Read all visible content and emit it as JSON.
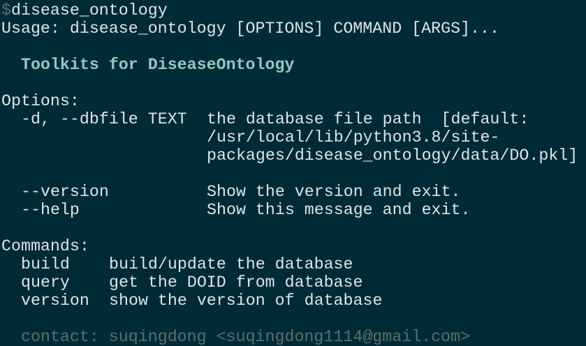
{
  "prompt": {
    "symbol": "$",
    "command": "disease_ontology"
  },
  "usage": "Usage: disease_ontology [OPTIONS] COMMAND [ARGS]...",
  "description": "Toolkits for DiseaseOntology",
  "options": {
    "header": "Options:",
    "items": [
      {
        "flag": "-d, --dbfile TEXT",
        "desc_lines": [
          "the database file path  [default:",
          "/usr/local/lib/python3.8/site-",
          "packages/disease_ontology/data/DO.pkl]"
        ]
      },
      {
        "flag": "--version",
        "desc_lines": [
          "Show the version and exit."
        ]
      },
      {
        "flag": "--help",
        "desc_lines": [
          "Show this message and exit."
        ]
      }
    ]
  },
  "commands": {
    "header": "Commands:",
    "items": [
      {
        "name": "build",
        "desc": "build/update the database"
      },
      {
        "name": "query",
        "desc": "get the DOID from database"
      },
      {
        "name": "version",
        "desc": "show the version of database"
      }
    ]
  },
  "contact": "contact: suqingdong <suqingdong1114@gmail.com>",
  "colors": {
    "background": "#002b36",
    "text": "#dde4e6",
    "title": "#93c7c0",
    "dim": "#5b6f6b",
    "prompt_symbol": "#586e75"
  }
}
